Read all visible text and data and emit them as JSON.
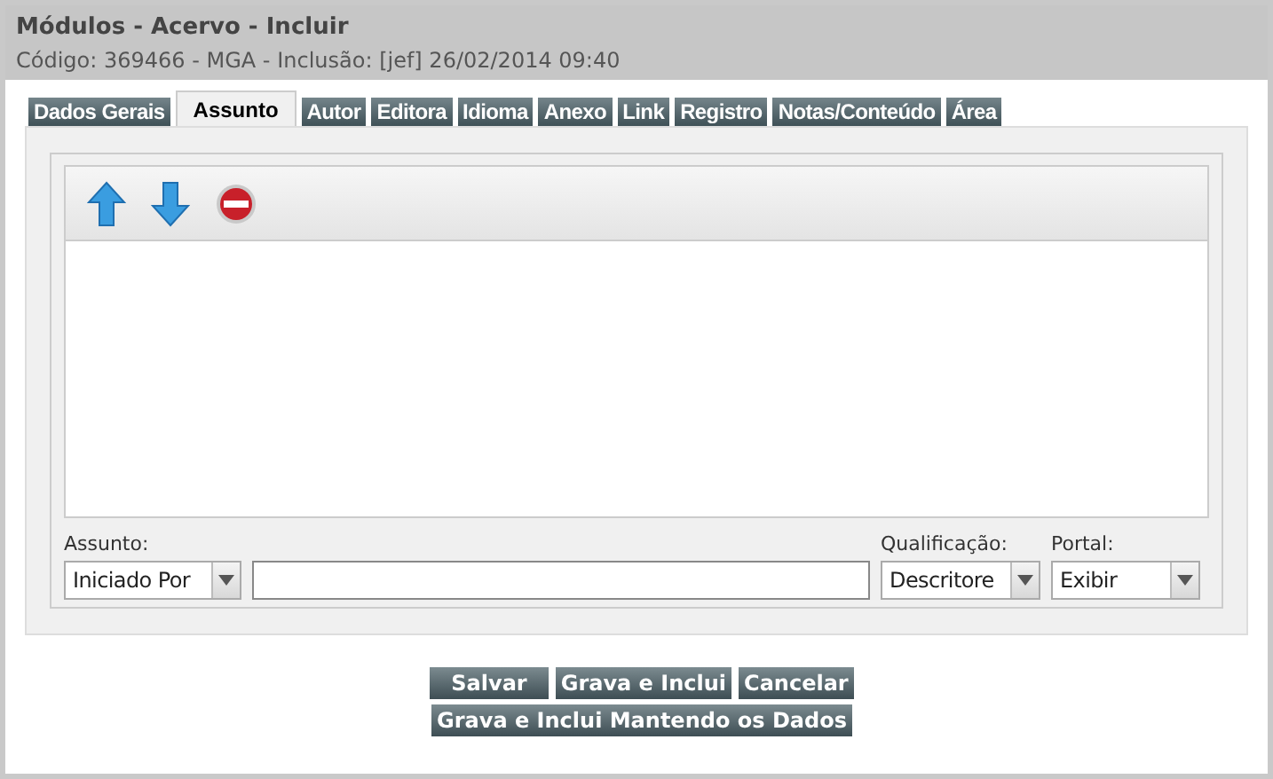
{
  "header": {
    "title": "Módulos - Acervo - Incluir",
    "subtitle": "Código: 369466 - MGA - Inclusão: [jef] 26/02/2014 09:40"
  },
  "tabs": [
    {
      "label": "Dados Gerais",
      "selected": false
    },
    {
      "label": "Assunto",
      "selected": true
    },
    {
      "label": "Autor",
      "selected": false
    },
    {
      "label": "Editora",
      "selected": false
    },
    {
      "label": "Idioma",
      "selected": false
    },
    {
      "label": "Anexo",
      "selected": false
    },
    {
      "label": "Link",
      "selected": false
    },
    {
      "label": "Registro",
      "selected": false
    },
    {
      "label": "Notas/Conteúdo",
      "selected": false
    },
    {
      "label": "Área",
      "selected": false
    }
  ],
  "form": {
    "assunto_label": "Assunto:",
    "assunto_select": "Iniciado Por",
    "qualificacao_label": "Qualificação:",
    "qualificacao_select": "Descritore",
    "portal_label": "Portal:",
    "portal_select": "Exibir"
  },
  "buttons": [
    "Salvar",
    "Grava e Inclui",
    "Cancelar"
  ],
  "wide_button": "Grava e Inclui Mantendo os Dados"
}
